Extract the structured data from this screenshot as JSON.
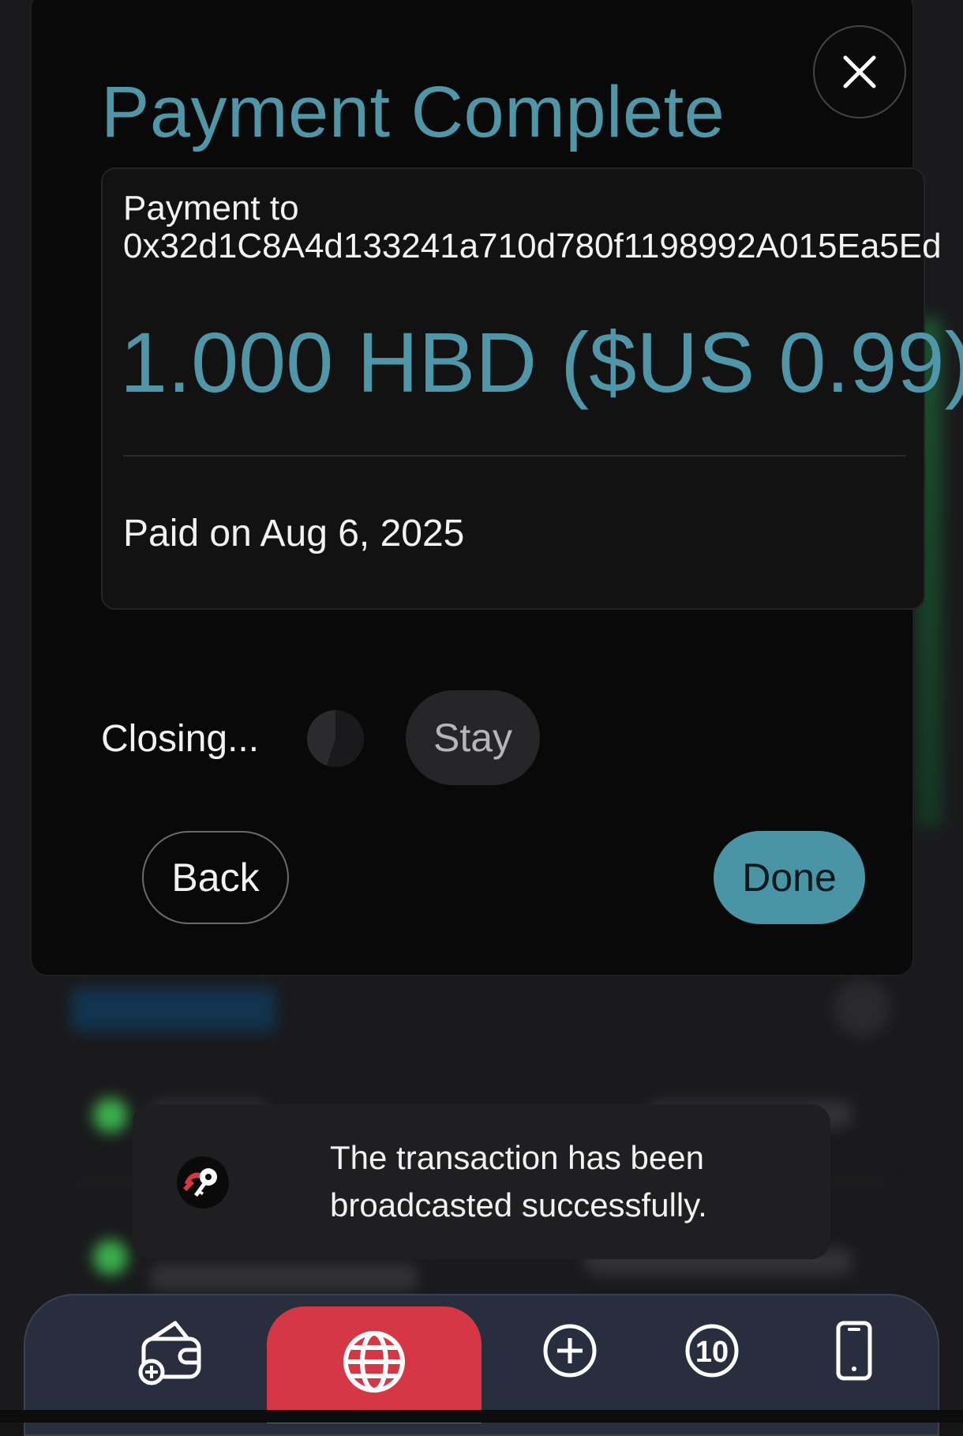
{
  "modal": {
    "title": "Payment Complete",
    "payment_label": "Payment to",
    "payment_address": "0x32d1C8A4d133241a710d780f1198992A015Ea5Ed",
    "amount": "1.000 HBD ($US 0.99)",
    "paid_on": "Paid on Aug 6, 2025",
    "closing_text": "Closing...",
    "stay_label": "Stay",
    "back_label": "Back",
    "done_label": "Done",
    "close_icon": "close-icon",
    "countdown_progress_percent": 55
  },
  "toast": {
    "message": "The transaction has been broadcasted successfully.",
    "icon": "key-logo-icon"
  },
  "nav": {
    "items": [
      {
        "icon": "wallet-add-icon"
      },
      {
        "icon": "globe-icon",
        "active": true
      },
      {
        "icon": "plus-circle-icon"
      },
      {
        "icon": "badge-10-icon",
        "label": "10"
      },
      {
        "icon": "phone-icon"
      }
    ]
  },
  "colors": {
    "accent": "#4f97a8",
    "nav_active": "#d63744",
    "nav_background": "#282e3e"
  }
}
